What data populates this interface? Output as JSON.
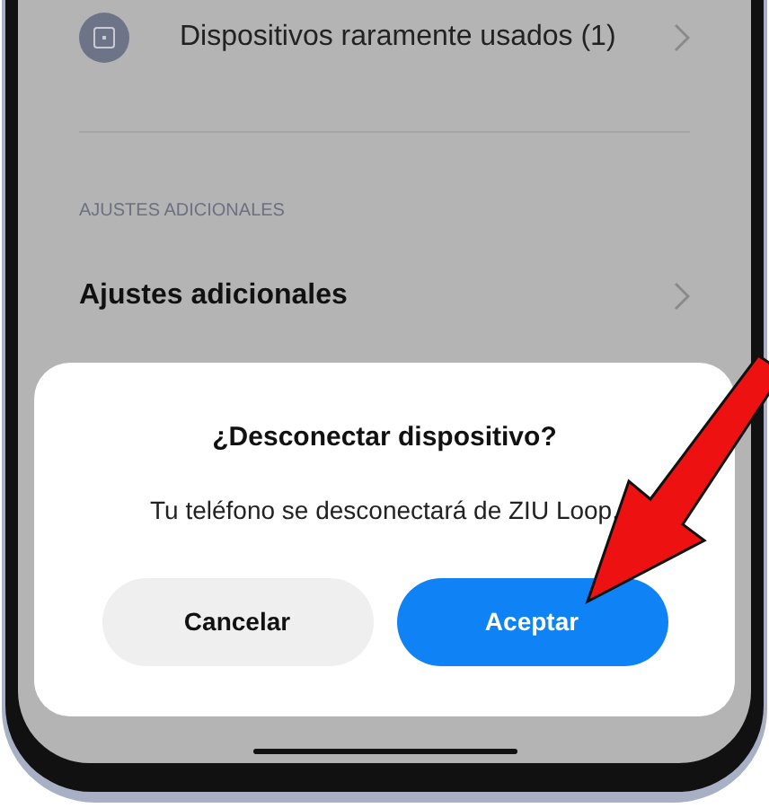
{
  "list_items": [
    {
      "label": "Dispositivos raramente usados (1)"
    }
  ],
  "section_header": "AJUSTES ADICIONALES",
  "settings_items": [
    {
      "label": "Ajustes adicionales"
    }
  ],
  "dialog": {
    "title": "¿Desconectar dispositivo?",
    "message": "Tu teléfono se desconectará de ZIU Loop.",
    "buttons": [
      {
        "label": "Cancelar",
        "kind": "secondary"
      },
      {
        "label": "Aceptar",
        "kind": "primary"
      }
    ]
  }
}
